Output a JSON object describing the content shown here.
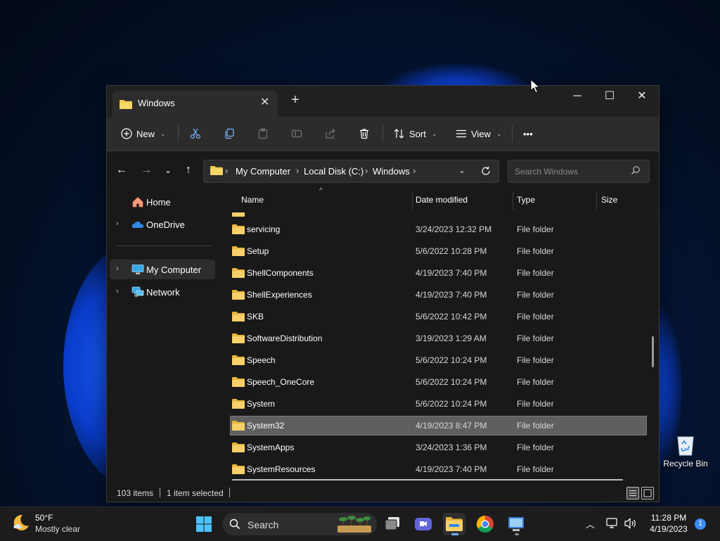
{
  "window": {
    "tab_title": "Windows",
    "new_tab_label": "+",
    "minimize_label": "─",
    "maximize_label": "☐",
    "close_label": "✕"
  },
  "commands": {
    "new_label": "New",
    "sort_label": "Sort",
    "view_label": "View",
    "more_label": "•••"
  },
  "address": {
    "crumbs": [
      "My Computer",
      "Local Disk (C:)",
      "Windows"
    ],
    "search_placeholder": "Search Windows"
  },
  "sidebar": {
    "items": [
      {
        "label": "Home",
        "icon": "home-icon"
      },
      {
        "label": "OneDrive",
        "icon": "onedrive-icon"
      },
      {
        "label": "My Computer",
        "icon": "computer-icon"
      },
      {
        "label": "Network",
        "icon": "network-icon"
      }
    ]
  },
  "columns": {
    "name": "Name",
    "date": "Date modified",
    "type": "Type",
    "size": "Size"
  },
  "files": [
    {
      "name": "servicing",
      "date": "3/24/2023 12:32 PM",
      "type": "File folder"
    },
    {
      "name": "Setup",
      "date": "5/6/2022 10:28 PM",
      "type": "File folder"
    },
    {
      "name": "ShellComponents",
      "date": "4/19/2023 7:40 PM",
      "type": "File folder"
    },
    {
      "name": "ShellExperiences",
      "date": "4/19/2023 7:40 PM",
      "type": "File folder"
    },
    {
      "name": "SKB",
      "date": "5/6/2022 10:42 PM",
      "type": "File folder"
    },
    {
      "name": "SoftwareDistribution",
      "date": "3/19/2023 1:29 AM",
      "type": "File folder"
    },
    {
      "name": "Speech",
      "date": "5/6/2022 10:24 PM",
      "type": "File folder"
    },
    {
      "name": "Speech_OneCore",
      "date": "5/6/2022 10:24 PM",
      "type": "File folder"
    },
    {
      "name": "System",
      "date": "5/6/2022 10:24 PM",
      "type": "File folder"
    },
    {
      "name": "System32",
      "date": "4/19/2023 8:47 PM",
      "type": "File folder",
      "selected": true
    },
    {
      "name": "SystemApps",
      "date": "3/24/2023 1:36 PM",
      "type": "File folder"
    },
    {
      "name": "SystemResources",
      "date": "4/19/2023 7:40 PM",
      "type": "File folder"
    }
  ],
  "status": {
    "item_count": "103 items",
    "selection": "1 item selected"
  },
  "desktop": {
    "recycle_bin_label": "Recycle Bin"
  },
  "taskbar": {
    "weather_temp": "50°F",
    "weather_condition": "Mostly clear",
    "search_label": "Search",
    "time": "11:28 PM",
    "date": "4/19/2023",
    "notification_count": "1"
  },
  "colors": {
    "accent": "#3a8df0",
    "folder": "#f2c94c",
    "selection": "#5f5f5f"
  }
}
